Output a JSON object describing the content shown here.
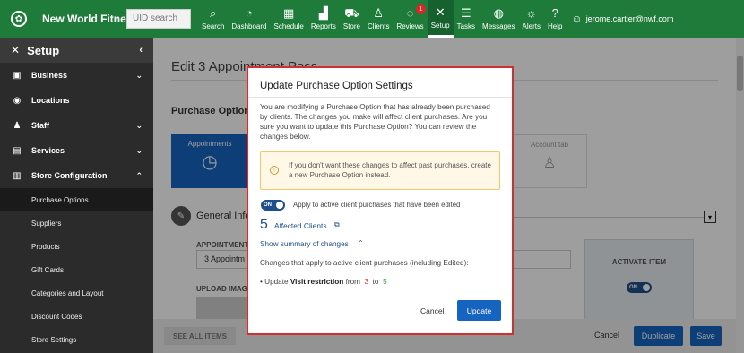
{
  "topbar": {
    "brand": "New World Fitness",
    "uid_placeholder": "UID search",
    "nav": [
      {
        "label": "Search",
        "icon": "search-icon"
      },
      {
        "label": "Dashboard",
        "icon": "dashboard-icon"
      },
      {
        "label": "Schedule",
        "icon": "calendar-icon"
      },
      {
        "label": "Reports",
        "icon": "chart-icon"
      },
      {
        "label": "Store",
        "icon": "cart-icon"
      },
      {
        "label": "Clients",
        "icon": "person-icon"
      },
      {
        "label": "Reviews",
        "icon": "chat-icon",
        "badge": "1"
      },
      {
        "label": "Setup",
        "icon": "tools-icon",
        "active": true
      },
      {
        "label": "Tasks",
        "icon": "checklist-icon"
      },
      {
        "label": "Messages",
        "icon": "message-icon"
      },
      {
        "label": "Alerts",
        "icon": "bell-icon"
      },
      {
        "label": "Help",
        "icon": "help-icon"
      }
    ],
    "user": "jerome.cartier@nwf.com"
  },
  "sidebar": {
    "header": "Setup",
    "items": [
      {
        "label": "Business",
        "icon": "briefcase-icon"
      },
      {
        "label": "Locations",
        "icon": "pin-icon"
      },
      {
        "label": "Staff",
        "icon": "staff-icon"
      },
      {
        "label": "Services",
        "icon": "services-icon"
      },
      {
        "label": "Store Configuration",
        "icon": "store-icon"
      }
    ],
    "subitems": [
      "Purchase Options",
      "Suppliers",
      "Products",
      "Gift Cards",
      "Categories and Layout",
      "Discount Codes",
      "Store Settings"
    ]
  },
  "main": {
    "title": "Edit 3 Appointment Pass",
    "section": "Purchase Option S",
    "tile_appointments": "Appointments",
    "tile_account": "Account tab",
    "general": "General Info",
    "appointment_label": "APPOINTMENT",
    "appointment_value": "3 Appointm",
    "upload_label": "UPLOAD IMAG",
    "activate_label": "ACTIVATE ITEM",
    "activate_toggle": "ON",
    "see_all": "SEE ALL ITEMS",
    "cancel": "Cancel",
    "duplicate": "Duplicate",
    "save": "Save"
  },
  "modal": {
    "title": "Update Purchase Option Settings",
    "description": "You are modifying a Purchase Option that has already been purchased by clients. The changes you make will affect client purchases. Are you sure you want to update this Purchase Option? You can review the changes below.",
    "warning": "If you don't want these changes to affect past purchases, create a new Purchase Option instead.",
    "toggle_state": "ON",
    "toggle_label": "Apply to active client purchases that have been edited",
    "affected_count": "5",
    "affected_label": "Affected Clients",
    "summary_link": "Show summary of changes",
    "changes_heading": "Changes that apply to active client purchases (including Edited):",
    "update_prefix": "Update",
    "update_field": "Visit restriction",
    "update_from_word": "from",
    "update_from": "3",
    "update_to_word": "to",
    "update_to": "5",
    "cancel_label": "Cancel",
    "update_label": "Update"
  },
  "colors": {
    "brand_green": "#1e7b3a",
    "primary_blue": "#1565c0",
    "modal_border": "#d32f2f",
    "from_value": "#d32f2f",
    "to_value": "#2e9e46"
  }
}
